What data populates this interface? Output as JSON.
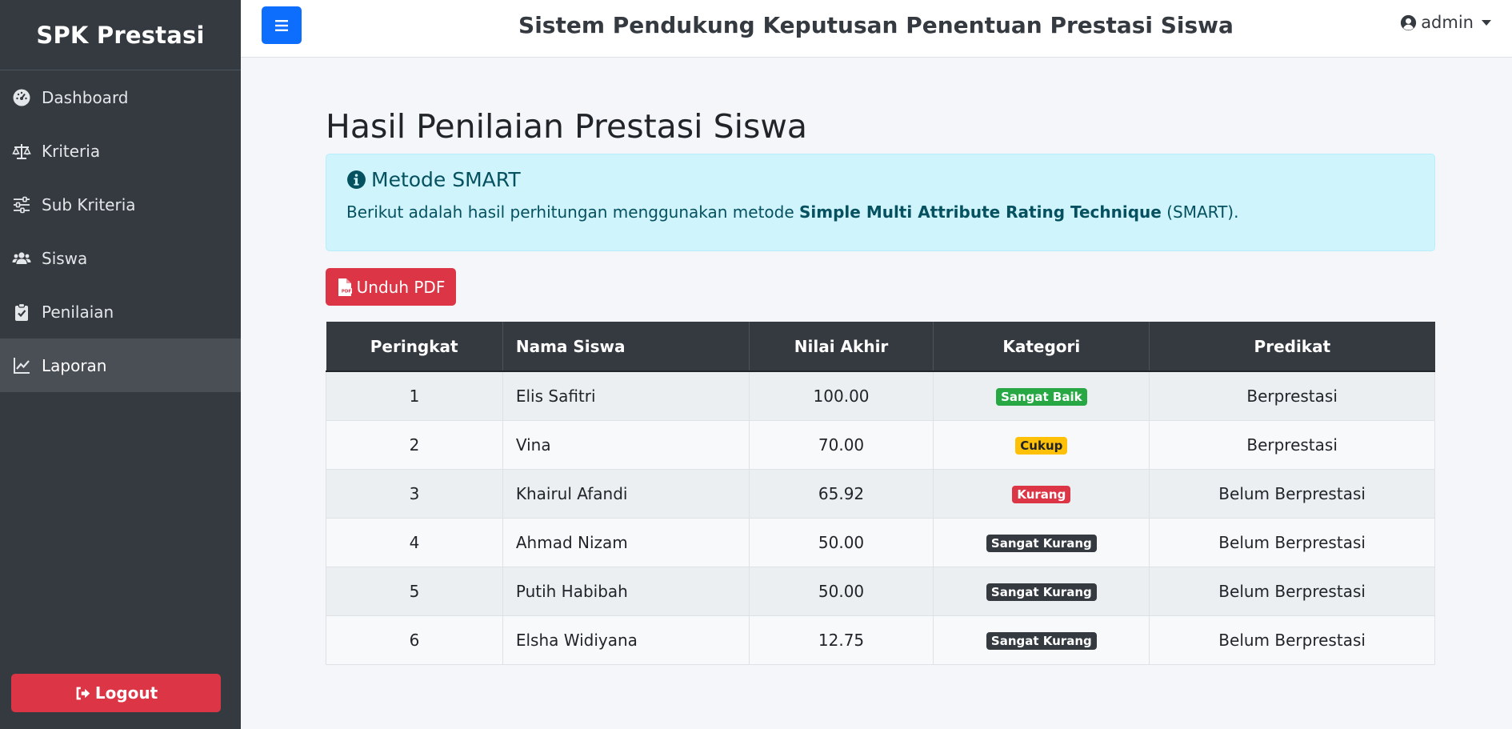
{
  "sidebar": {
    "brand": "SPK Prestasi",
    "items": [
      {
        "label": "Dashboard",
        "icon": "dashboard-icon"
      },
      {
        "label": "Kriteria",
        "icon": "balance-scale-icon"
      },
      {
        "label": "Sub Kriteria",
        "icon": "sliders-icon"
      },
      {
        "label": "Siswa",
        "icon": "users-icon"
      },
      {
        "label": "Penilaian",
        "icon": "clipboard-check-icon"
      },
      {
        "label": "Laporan",
        "icon": "chart-line-icon",
        "active": true
      }
    ],
    "logout_label": "Logout"
  },
  "topbar": {
    "title": "Sistem Pendukung Keputusan Penentuan Prestasi Siswa",
    "user": "admin"
  },
  "main": {
    "page_title": "Hasil Penilaian Prestasi Siswa",
    "alert": {
      "heading": "Metode SMART",
      "text_before": "Berikut adalah hasil perhitungan menggunakan metode ",
      "text_bold": "Simple Multi Attribute Rating Technique",
      "text_after": " (SMART)."
    },
    "pdf_button": "Unduh PDF",
    "table": {
      "headers": [
        "Peringkat",
        "Nama Siswa",
        "Nilai Akhir",
        "Kategori",
        "Predikat"
      ],
      "rows": [
        {
          "rank": "1",
          "name": "Elis Safitri",
          "score": "100.00",
          "category": "Sangat Baik",
          "predicate": "Berprestasi"
        },
        {
          "rank": "2",
          "name": "Vina",
          "score": "70.00",
          "category": "Cukup",
          "predicate": "Berprestasi"
        },
        {
          "rank": "3",
          "name": "Khairul Afandi",
          "score": "65.92",
          "category": "Kurang",
          "predicate": "Belum Berprestasi"
        },
        {
          "rank": "4",
          "name": "Ahmad Nizam",
          "score": "50.00",
          "category": "Sangat Kurang",
          "predicate": "Belum Berprestasi"
        },
        {
          "rank": "5",
          "name": "Putih Habibah",
          "score": "50.00",
          "category": "Sangat Kurang",
          "predicate": "Belum Berprestasi"
        },
        {
          "rank": "6",
          "name": "Elsha Widiyana",
          "score": "12.75",
          "category": "Sangat Kurang",
          "predicate": "Belum Berprestasi"
        }
      ]
    }
  },
  "colors": {
    "sidebar_bg": "#343a40",
    "primary": "#0d6efd",
    "danger": "#dc3545",
    "success": "#28a745",
    "warning": "#ffc107",
    "info_bg": "#cff4fc"
  }
}
